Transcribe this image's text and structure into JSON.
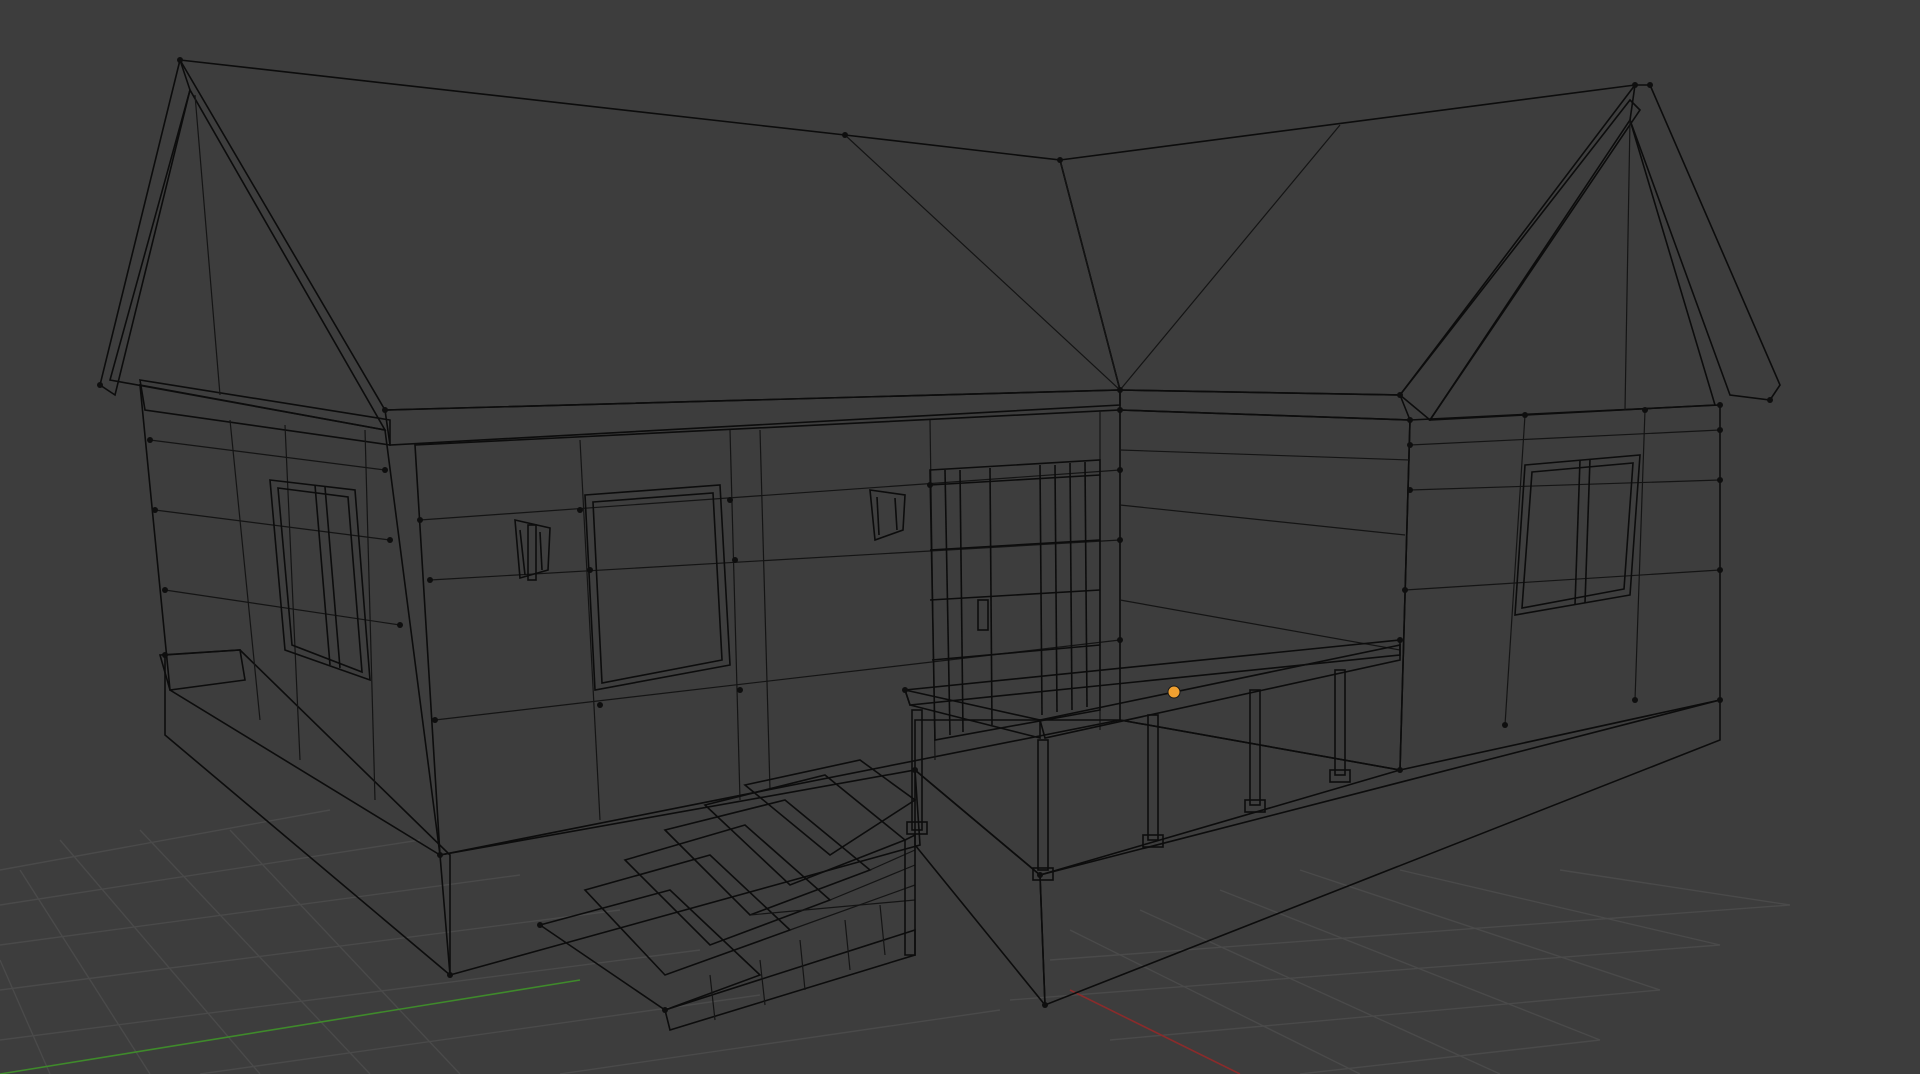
{
  "viewport": {
    "background": "#3d3d3d",
    "grid_color": "#4a4a4a",
    "axis_x_color": "#8a2b2b",
    "axis_y_color": "#3f8a2b",
    "object_origin_color": "#f0a030"
  },
  "model": {
    "shading": "solid",
    "overlay": "wireframe",
    "colors": {
      "roof_left": "#8a8aa0",
      "roof_right": "#a5a5ae",
      "wall_dark": "#5a5a6a",
      "wall_light": "#a8a8ab",
      "floor": "#9c9ca2",
      "steps": "#a2a2a6",
      "gable_side": "#a9a9ac",
      "gable_right": "#55556a",
      "porch_base": "#5e5e6d"
    }
  }
}
